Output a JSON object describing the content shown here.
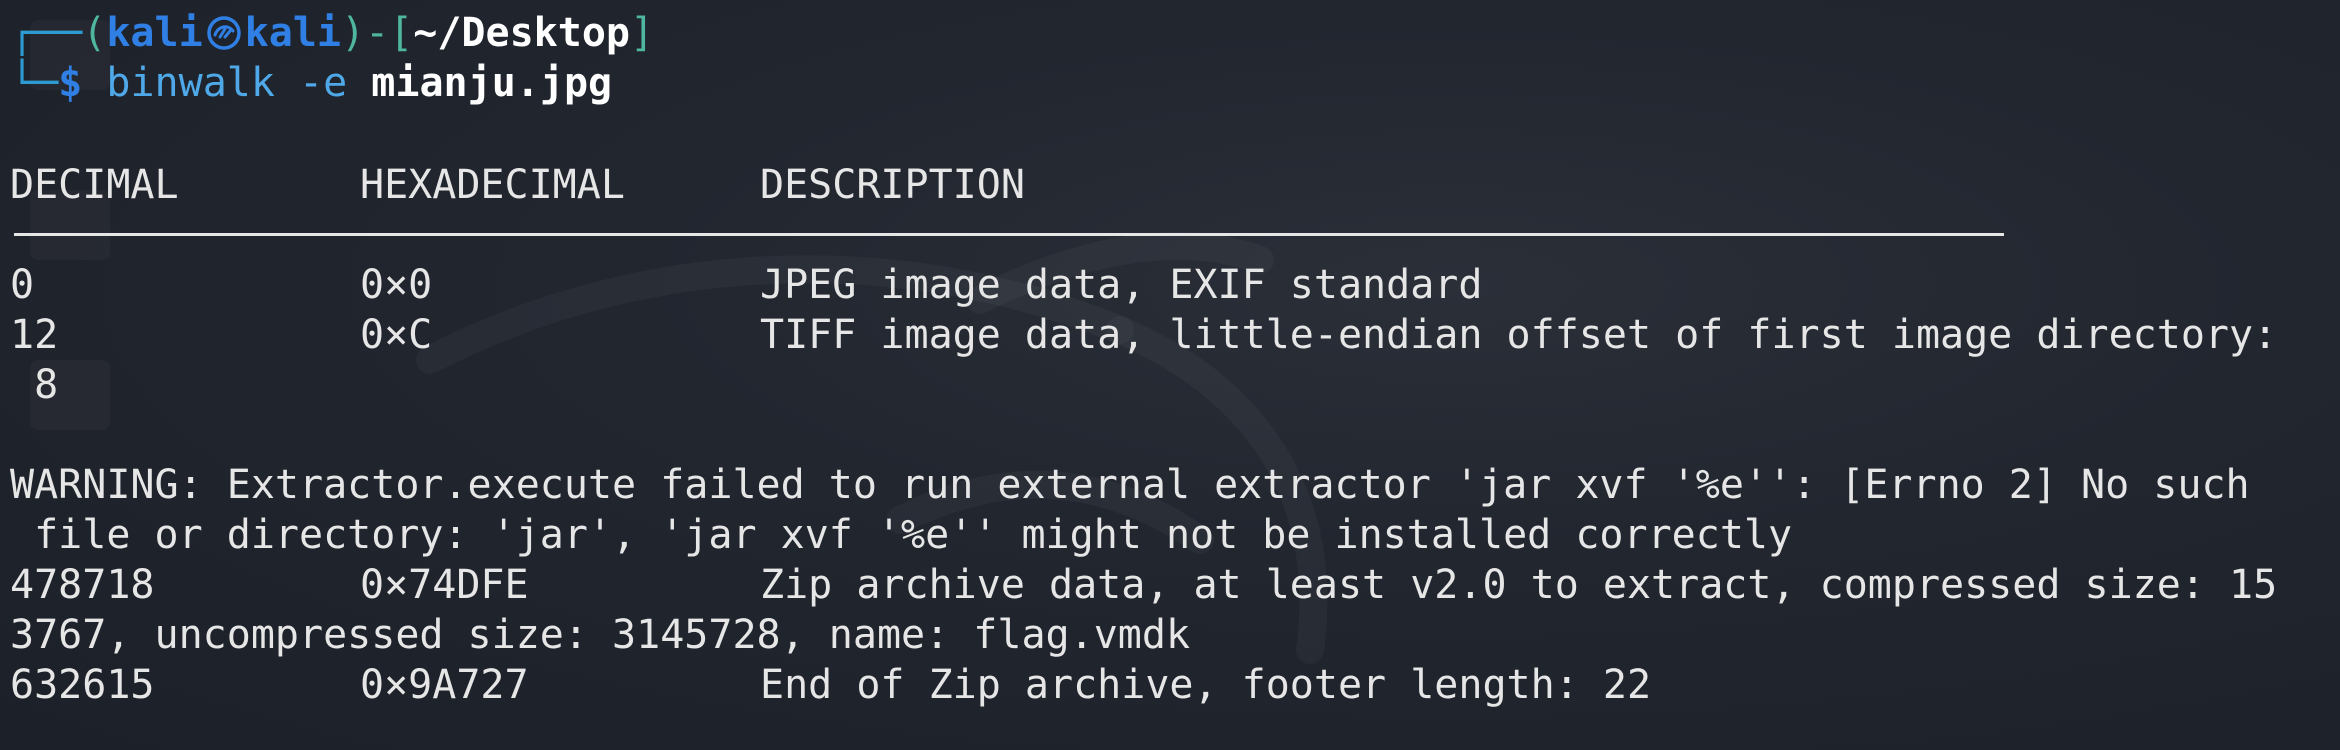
{
  "prompt": {
    "frame_top": "┌──",
    "open_paren": "(",
    "user": "kali",
    "icon": "kali-dragon-icon",
    "host": "kali",
    "close_paren_dash": ")-[",
    "path": "~/Desktop",
    "close_bracket": "]",
    "frame_bottom": "└─",
    "dollar": "$",
    "command": "binwalk -e",
    "argument": "mianju.jpg"
  },
  "table": {
    "headers": [
      "DECIMAL",
      "HEXADECIMAL",
      "DESCRIPTION"
    ],
    "rows": [
      {
        "decimal": "0",
        "hex": "0×0",
        "description": "JPEG image data, EXIF standard"
      },
      {
        "decimal": "12",
        "hex": "0×C",
        "description": "TIFF image data, little-endian offset of first image directory:"
      }
    ],
    "row2_wrap": " 8"
  },
  "warning": {
    "line1": "WARNING: Extractor.execute failed to run external extractor 'jar xvf '%e'': [Errno 2] No such",
    "line2": " file or directory: 'jar', 'jar xvf '%e'' might not be installed correctly"
  },
  "rows_after": [
    {
      "decimal": "478718",
      "hex": "0×74DFE",
      "description": "Zip archive data, at least v2.0 to extract, compressed size: 15"
    },
    {
      "decimal": "632615",
      "hex": "0×9A727",
      "description": "End of Zip archive, footer length: 22"
    }
  ],
  "zip_wrap": "3767, uncompressed size: 3145728, name: flag.vmdk",
  "colors": {
    "background": "#1e222b",
    "text": "#e6e6e6",
    "prompt_blue": "#2f7fe4",
    "prompt_teal": "#4fb6a0",
    "command_blue": "#4fa8e8"
  }
}
